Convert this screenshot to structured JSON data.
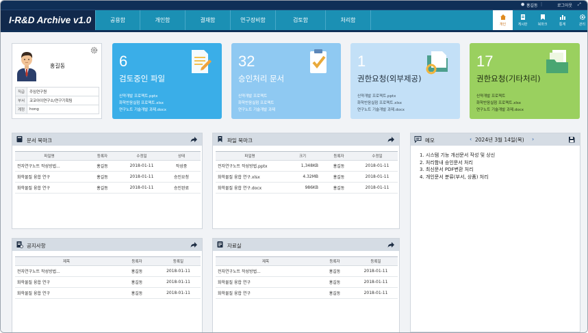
{
  "app_title": "I-R&D Archive v1.0",
  "topbar": {
    "user": "홍길동",
    "logout": "로그아웃"
  },
  "menu": [
    "공용함",
    "개인함",
    "결재함",
    "연구장비함",
    "검토함",
    "처리함"
  ],
  "nav_icons": [
    {
      "label": "개인",
      "icon": "home-icon"
    },
    {
      "label": "게시판",
      "icon": "board-icon"
    },
    {
      "label": "북마크",
      "icon": "bookmark-icon"
    },
    {
      "label": "통계",
      "icon": "stats-icon"
    },
    {
      "label": "관리",
      "icon": "gear-icon"
    }
  ],
  "profile": {
    "name": "홍길동",
    "rows": [
      {
        "key": "직급",
        "value": "주임연구원"
      },
      {
        "key": "부서",
        "value": "코코아이연구소/연구기획팀"
      },
      {
        "key": "계정",
        "value": "hong"
      }
    ]
  },
  "cards": [
    {
      "count": "6",
      "title": "검토중인 파일",
      "files": [
        "신약개발 프로젝트.pptx",
        "화학반응실험 프로젝트.xlsx",
        "연구노트 기술개발 과제.docx"
      ],
      "color": "#3aaee8"
    },
    {
      "count": "32",
      "title": "승인처리 문서",
      "files": [
        "신약개발 프로젝트",
        "화학반응실험 프로젝트",
        "연구노트 기술개발 과제"
      ],
      "color": "#8fc9f2"
    },
    {
      "count": "1",
      "title": "권한요청(외부제공)",
      "files": [
        "신약개발 프로젝트.pptx",
        "화학반응실험 프로젝트.xlsx",
        "연구노트 기술개발 과제.docx"
      ],
      "color": "#c3e0f7"
    },
    {
      "count": "17",
      "title": "권한요청(기타처리)",
      "files": [
        "신약개발 프로젝트",
        "화학반응실험 프로젝트.xlsx",
        "연구노트 기술개발 과제.docx"
      ],
      "color": "#9ad05f"
    }
  ],
  "doc_bookmark": {
    "title": "문서 북마크",
    "columns": [
      "파일명",
      "등록자",
      "수정일",
      "상태"
    ],
    "rows": [
      [
        "전자연구노트 작성방법...",
        "홍길동",
        "2018-01-11",
        "작성중"
      ],
      [
        "화학물질 융합 연구",
        "홍길동",
        "2018-01-11",
        "승인요청"
      ],
      [
        "화학물질 융합 연구",
        "홍길동",
        "2018-01-11",
        "승인완료"
      ]
    ]
  },
  "file_bookmark": {
    "title": "파일 북마크",
    "columns": [
      "파일명",
      "크기",
      "등록자",
      "수정일"
    ],
    "rows": [
      [
        "전자연구노트 작성방법.pptx",
        "1,348KB",
        "홍길동",
        "2018-01-11"
      ],
      [
        "화학물질 융합 연구.xlsx",
        "4.32MB",
        "홍길동",
        "2018-01-11"
      ],
      [
        "화학물질 융합 연구.docx",
        "986KB",
        "홍길동",
        "2018-01-11"
      ]
    ]
  },
  "notice": {
    "title": "공지사항",
    "columns": [
      "제목",
      "등록자",
      "등록일"
    ],
    "rows": [
      [
        "전자연구노트 작성방법...",
        "홍길동",
        "2018-01-11"
      ],
      [
        "화학물질 융합 연구",
        "홍길동",
        "2018-01-11"
      ],
      [
        "화학물질 융합 연구",
        "홍길동",
        "2018-01-11"
      ]
    ]
  },
  "library": {
    "title": "자료실",
    "columns": [
      "제목",
      "등록자",
      "등록일"
    ],
    "rows": [
      [
        "전자연구노트 작성방법...",
        "홍길동",
        "2018-01-11"
      ],
      [
        "화학물질 융합 연구",
        "홍길동",
        "2018-01-11"
      ],
      [
        "화학물질 융합 연구",
        "홍길동",
        "2018-01-11"
      ]
    ]
  },
  "memo": {
    "title": "메모",
    "date": "2024년 3월 14일(목)",
    "items": [
      "1. 시스템 기능 개선문서 작성 및 상신",
      "2. 처리함내 승인문서 처리",
      "3. 최신문서 PDF변환 처리",
      "4. 개인문서 분류(부서, 상품) 처리"
    ]
  }
}
